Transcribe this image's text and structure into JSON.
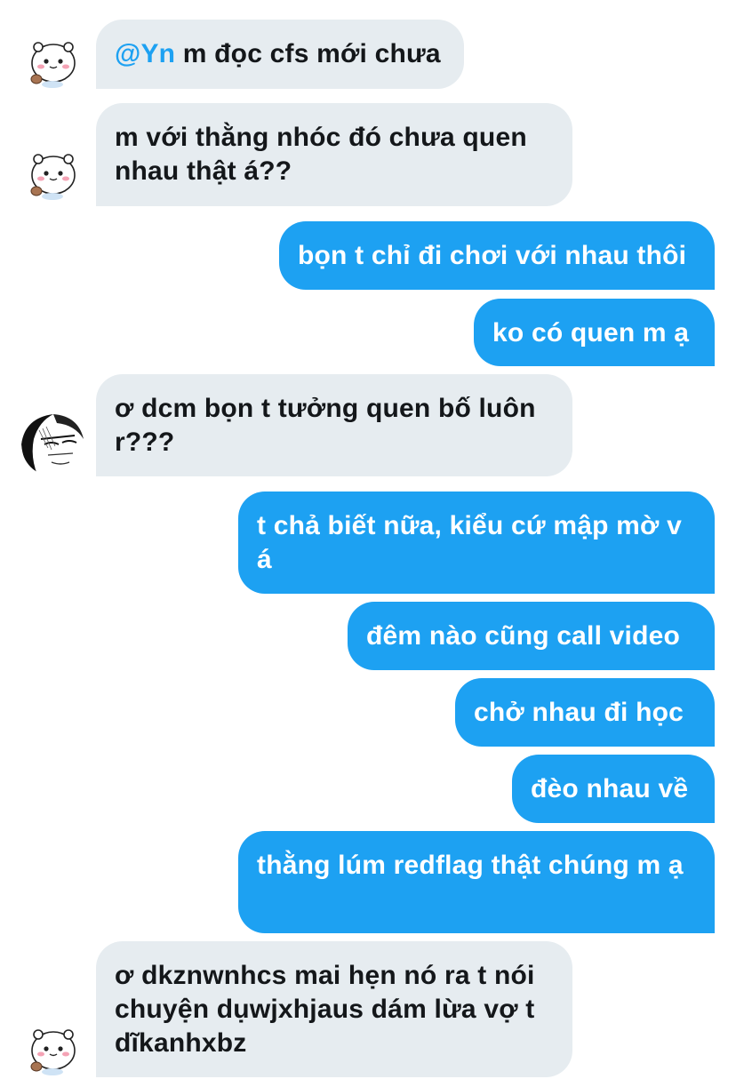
{
  "messages": [
    {
      "side": "in",
      "mention": "@Yn",
      "text": " m đọc cfs mới chưa"
    },
    {
      "side": "in",
      "text": "m với thằng nhóc đó chưa quen nhau thật á??"
    },
    {
      "side": "out",
      "text": "bọn t chỉ đi chơi với nhau thôi"
    },
    {
      "side": "out",
      "text": "ko có quen m ạ"
    },
    {
      "side": "in",
      "text": "ơ dcm bọn t tưởng quen bố luôn r???"
    },
    {
      "side": "out",
      "text": "t chả biết nữa, kiểu cứ mập mờ v á"
    },
    {
      "side": "out",
      "text": "đêm nào cũng call video"
    },
    {
      "side": "out",
      "text": "chở nhau đi học"
    },
    {
      "side": "out",
      "text": "đèo nhau về"
    },
    {
      "side": "out",
      "text": "thằng lúm redflag thật chúng m ạ"
    },
    {
      "side": "in",
      "text": "ơ dkznwnhcs mai hẹn nó ra t nói chuyện dụwjxhjaus dám lừa vợ t dĩkanhxbz"
    }
  ],
  "avatars": {
    "bear": "bear-avatar-icon",
    "sketch": "sketch-face-avatar-icon"
  },
  "colors": {
    "incoming_bg": "#e6ecf0",
    "outgoing_bg": "#1da1f2",
    "mention": "#1da1f2"
  }
}
